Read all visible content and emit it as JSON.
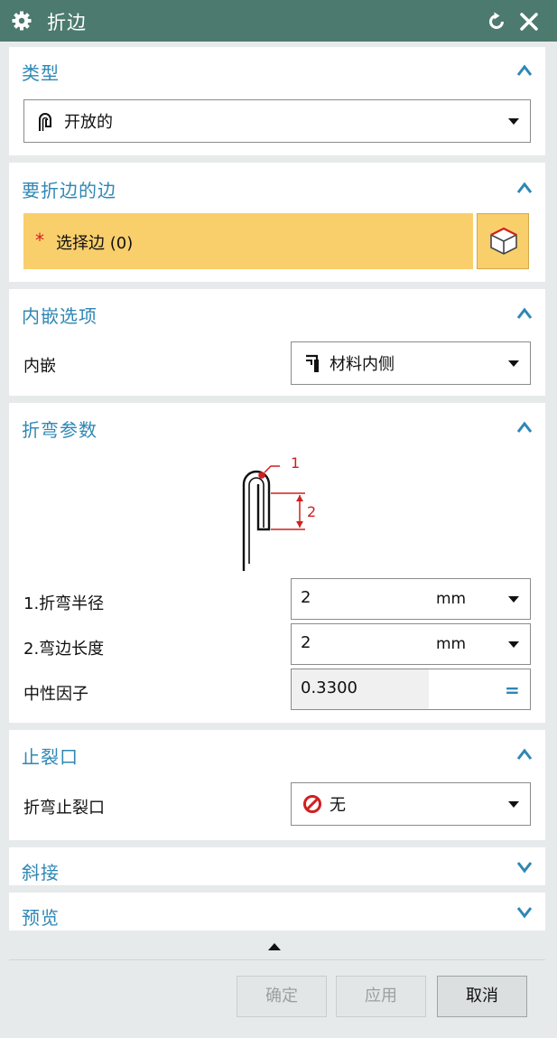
{
  "window": {
    "title": "折边",
    "icon": "gear-icon"
  },
  "sections": {
    "type": {
      "title": "类型",
      "dropdown": {
        "icon": "open-hem-icon",
        "value": "开放的"
      }
    },
    "edges": {
      "title": "要折边的边",
      "required_mark": "*",
      "select_label": "选择边 (0)",
      "select_icon": "cube-select-icon"
    },
    "inset": {
      "title": "内嵌选项",
      "label": "内嵌",
      "dropdown": {
        "icon": "material-inside-icon",
        "value": "材料内侧"
      }
    },
    "bend": {
      "title": "折弯参数",
      "diagram_labels": [
        "1",
        "2"
      ],
      "fields": [
        {
          "label": "1.折弯半径",
          "value": "2",
          "unit": "mm"
        },
        {
          "label": "2.弯边长度",
          "value": "2",
          "unit": "mm"
        },
        {
          "label": "中性因子",
          "value": "0.3300",
          "suffix": "="
        }
      ]
    },
    "relief": {
      "title": "止裂口",
      "label": "折弯止裂口",
      "dropdown": {
        "icon": "none-icon",
        "value": "无"
      }
    },
    "miter": {
      "title": "斜接"
    },
    "preview": {
      "title": "预览"
    }
  },
  "buttons": {
    "ok": "确定",
    "apply": "应用",
    "cancel": "取消"
  },
  "colors": {
    "titlebar": "#4c7a6e",
    "section_title": "#2f87b5",
    "selection_highlight": "#f9cf6c",
    "diagram_annotation": "#d21f1f"
  }
}
